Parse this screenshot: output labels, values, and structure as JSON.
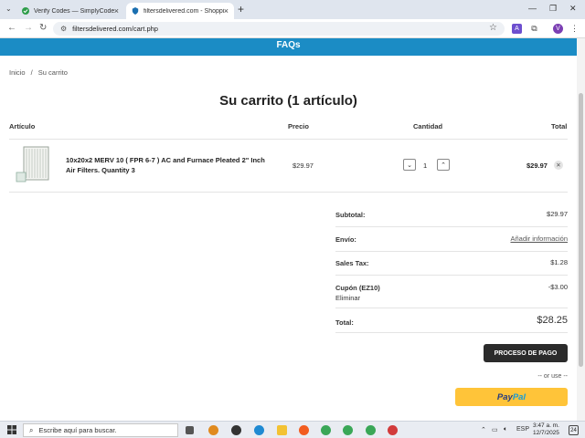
{
  "browser": {
    "tabs": [
      {
        "label": "Verify Codes — SimplyCodes",
        "active": false
      },
      {
        "label": "filtersdelivered.com - Shopping",
        "active": true
      }
    ],
    "new_tab": "+",
    "url": "filtersdelivered.com/cart.php",
    "profile_initial": "V",
    "extension_letter": "A"
  },
  "page": {
    "banner": "FAQs",
    "breadcrumb": [
      "Inicio",
      "/",
      "Su carrito"
    ],
    "title": "Su carrito (1 artículo)",
    "columns": {
      "item": "Artículo",
      "price": "Precio",
      "quantity": "Cantidad",
      "total": "Total"
    },
    "items": [
      {
        "name": "10x20x2 MERV 10 ( FPR 6-7 ) AC and Furnace Pleated 2\" Inch Air Filters. Quantity 3",
        "price": "$29.97",
        "quantity": "1",
        "total": "$29.97"
      }
    ],
    "summary": {
      "subtotal_label": "Subtotal:",
      "subtotal_value": "$29.97",
      "shipping_label": "Envío:",
      "shipping_value": "Añadir información",
      "tax_label": "Sales Tax:",
      "tax_value": "$1.28",
      "coupon_label": "Cupón (EZ10)",
      "coupon_remove": "Eliminar",
      "coupon_value": "-$3.00",
      "total_label": "Total:",
      "total_value": "$28.25"
    },
    "checkout_button": "PROCESO DE PAGO",
    "or_use": "-- or use --",
    "paypal": {
      "part1": "Pay",
      "part2": "Pal"
    }
  },
  "taskbar": {
    "search_placeholder": "Escribe aquí para buscar.",
    "language": "ESP",
    "time": "3:47 a. m.",
    "date": "12/7/2025",
    "notifications": "24"
  },
  "colors": {
    "banner": "#1b8cc5",
    "checkout": "#2b2b2b",
    "paypal": "#ffc439"
  }
}
